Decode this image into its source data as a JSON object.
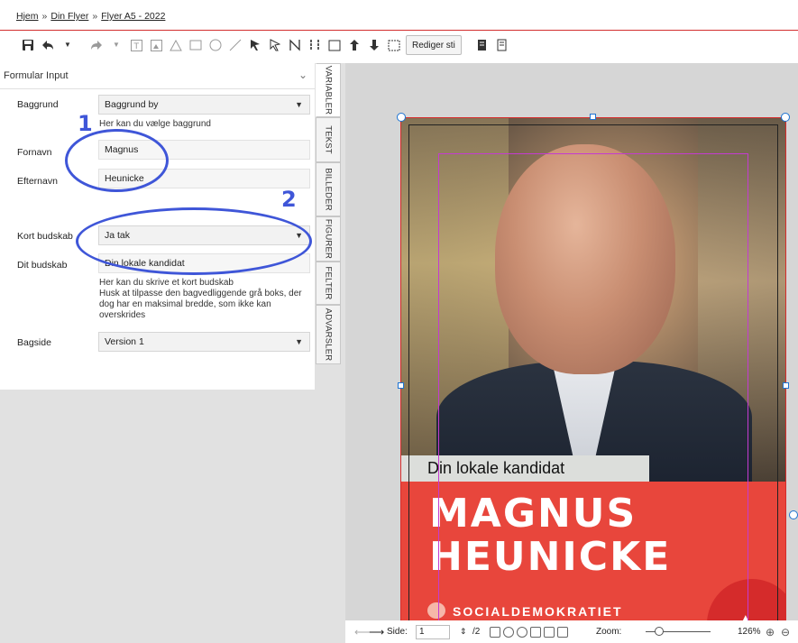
{
  "breadcrumb": {
    "items": [
      "Hjem",
      "Din Flyer",
      "Flyer A5 - 2022"
    ],
    "separator": "»"
  },
  "toolbar": {
    "edit_path_label": "Rediger sti",
    "icons": [
      "save-icon",
      "undo-icon",
      "undo-dropdown-icon",
      "redo-icon",
      "redo-dropdown-icon",
      "text-frame-icon",
      "image-frame-icon",
      "triangle-icon",
      "rectangle-icon",
      "ellipse-icon",
      "line-icon",
      "select-arrow-icon",
      "direct-select-arrow-icon",
      "pen-path-icon",
      "pen-path-alt-icon",
      "frame-icon",
      "bring-forward-icon",
      "send-backward-icon",
      "frame-alt-icon",
      "page-icon",
      "page-alt-icon"
    ]
  },
  "panel": {
    "title": "Formular Input",
    "fields": {
      "baggrund_label": "Baggrund",
      "baggrund_value": "Baggrund by",
      "baggrund_help": "Her kan du vælge baggrund",
      "fornavn_label": "Fornavn",
      "fornavn_value": "Magnus",
      "efternavn_label": "Efternavn",
      "efternavn_value": "Heunicke",
      "kort_label": "Kort budskab",
      "kort_value": "Ja tak",
      "dit_label": "Dit budskab",
      "dit_value": "Din lokale kandidat",
      "dit_help_1": "Her kan du skrive et kort budskab",
      "dit_help_2": "Husk at tilpasse den bagvedliggende grå boks, der dog har en maksimal bredde, som ikke kan overskrides",
      "bagside_label": "Bagside",
      "bagside_value": "Version 1"
    },
    "tabs": [
      "VARIABLER",
      "TEKST",
      "BILLEDER",
      "FIGURER",
      "FELTER",
      "ADVARSLER"
    ]
  },
  "annotations": {
    "one": "1",
    "two": "2"
  },
  "flyer": {
    "tagline": "Din lokale kandidat",
    "first_name": "MAGNUS",
    "last_name": "HEUNICKE",
    "party": "SOCIALDEMOKRATIET"
  },
  "footer": {
    "side_label": "Side:",
    "page_value": "1",
    "page_total": "/2",
    "zoom_label": "Zoom:",
    "zoom_value": "126%"
  },
  "colors": {
    "accent_red": "#d32f2f",
    "annotation_blue": "#3f56d8",
    "flyer_red": "#e8463c"
  }
}
